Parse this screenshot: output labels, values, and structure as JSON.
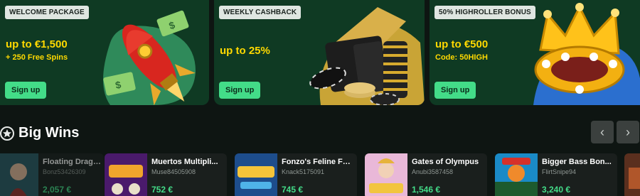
{
  "promos": [
    {
      "tag": "WELCOME PACKAGE",
      "headline": "up to €1,500",
      "sub": "+ 250 Free Spins",
      "button": "Sign up",
      "art": "rocket-money-art"
    },
    {
      "tag": "WEEKLY CASHBACK",
      "headline": "up to 25%",
      "sub": "",
      "button": "Sign up",
      "art": "wallet-chips-art"
    },
    {
      "tag": "50% HIGHROLLER BONUS",
      "headline": "up to €500",
      "sub": "Code: 50HIGH",
      "button": "Sign up",
      "art": "golden-crown-art"
    }
  ],
  "big_wins": {
    "title": "Big Wins",
    "icon": "star-icon",
    "prev": "‹",
    "next": "›",
    "items": [
      {
        "game": "Floating Dragon",
        "user": "Bonz53426309",
        "amount": "2,057 €"
      },
      {
        "game": "Muertos Multipli...",
        "user": "Muse84505908",
        "amount": "752 €"
      },
      {
        "game": "Fonzo's Feline Fo...",
        "user": "Knack5175091",
        "amount": "745 €"
      },
      {
        "game": "Gates of Olympus",
        "user": "Anubi3587458",
        "amount": "1,546 €"
      },
      {
        "game": "Bigger Bass Bon...",
        "user": "FlirtSnipe94",
        "amount": "3,240 €"
      }
    ]
  },
  "colors": {
    "card": "#0f3a23",
    "accent": "#43dc88",
    "highlight": "#ffd900",
    "background": "#0e1512"
  }
}
